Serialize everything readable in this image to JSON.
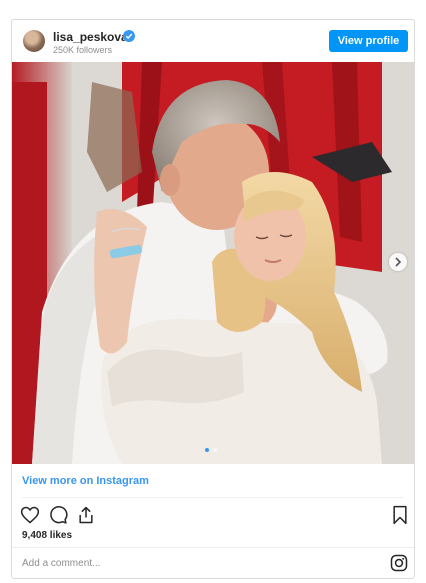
{
  "header": {
    "username": "lisa_peskova",
    "followers": "250K followers",
    "view_profile_label": "View profile"
  },
  "post": {
    "carousel": {
      "slides": 2,
      "active_index": 0
    },
    "view_more_label": "View more on Instagram",
    "likes": "9,408 likes",
    "comment_placeholder": "Add a comment..."
  },
  "icons": {
    "verified": "verified-badge-icon",
    "next": "chevron-right-icon",
    "like": "heart-icon",
    "comment": "comment-icon",
    "share": "share-icon",
    "save": "bookmark-icon",
    "instagram": "instagram-logo-icon"
  },
  "colors": {
    "accent": "#0095f6",
    "link": "#3897f0",
    "text": "#262626",
    "muted": "#8e8e8e"
  }
}
